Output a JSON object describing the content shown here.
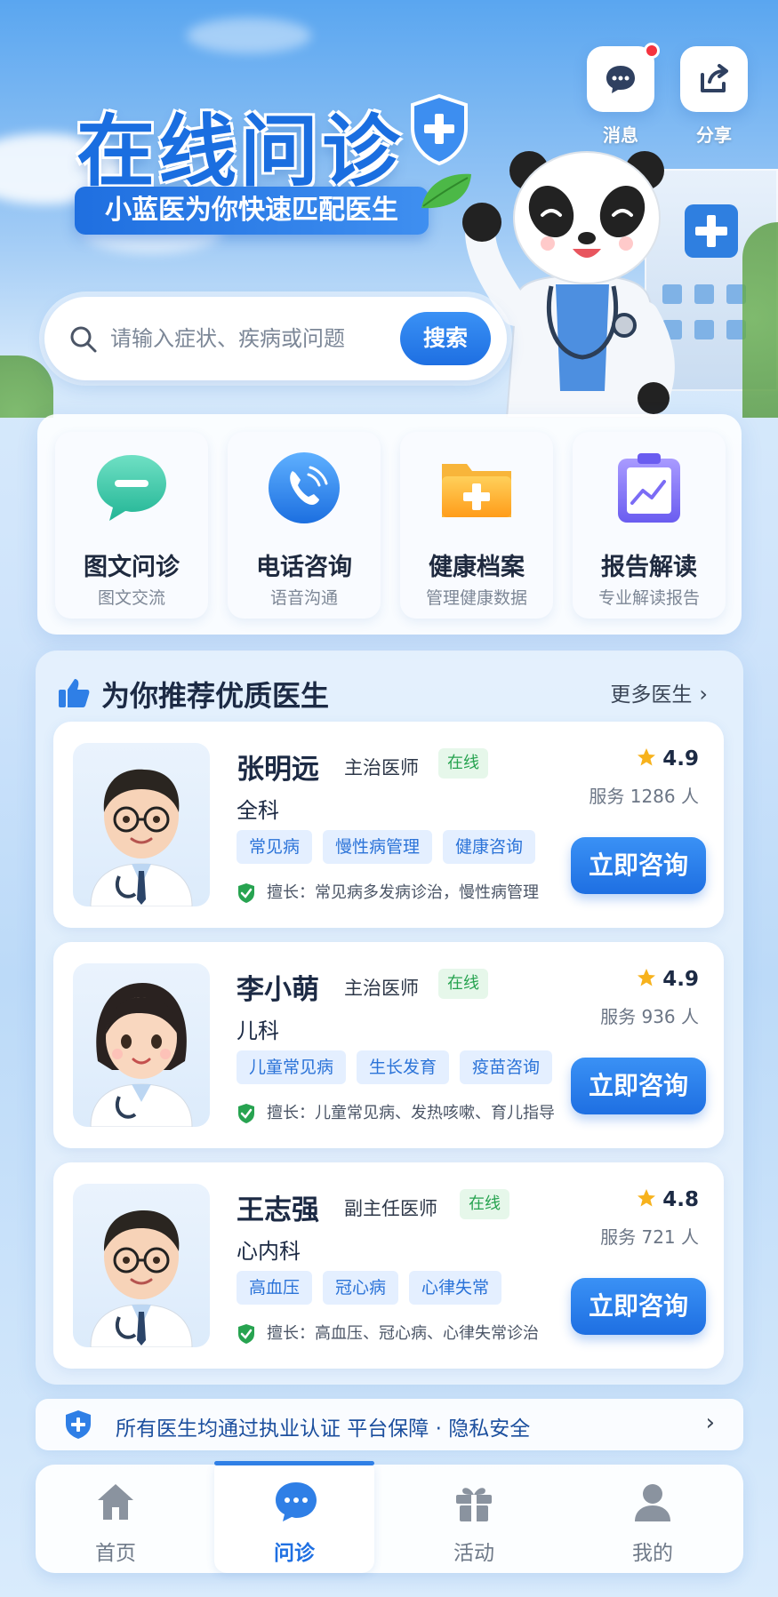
{
  "hero": {
    "title": "在线问诊",
    "subtitle": "小蓝医为你快速匹配医生",
    "actions": [
      {
        "label": "消息",
        "icon": "message-icon",
        "has_badge": true
      },
      {
        "label": "分享",
        "icon": "share-icon"
      }
    ]
  },
  "search": {
    "placeholder": "请输入症状、疾病或问题",
    "button_label": "搜索"
  },
  "services": [
    {
      "title": "图文问诊",
      "subtitle": "图文交流",
      "icon": "chat-bubble-icon"
    },
    {
      "title": "电话咨询",
      "subtitle": "语音沟通",
      "icon": "phone-icon"
    },
    {
      "title": "健康档案",
      "subtitle": "管理健康数据",
      "icon": "health-folder-icon"
    },
    {
      "title": "报告解读",
      "subtitle": "专业解读报告",
      "icon": "report-clipboard-icon"
    }
  ],
  "doctors_section": {
    "title": "为你推荐优质医生",
    "more_label": "更多医生",
    "consult_label": "立即咨询",
    "doctors": [
      {
        "name": "张明远",
        "title": "主治医师",
        "status": "在线",
        "department": "全科",
        "tags": [
          "常见病",
          "慢性病管理",
          "健康咨询"
        ],
        "skill": "擅长：常见病多发病诊治，慢性病管理",
        "rating": "4.9",
        "served": "服务 1286 人"
      },
      {
        "name": "李小萌",
        "title": "主治医师",
        "status": "在线",
        "department": "儿科",
        "tags": [
          "儿童常见病",
          "生长发育",
          "疫苗咨询"
        ],
        "skill": "擅长：儿童常见病、发热咳嗽、育儿指导",
        "rating": "4.9",
        "served": "服务 936 人"
      },
      {
        "name": "王志强",
        "title": "副主任医师",
        "status": "在线",
        "department": "心内科",
        "tags": [
          "高血压",
          "冠心病",
          "心律失常"
        ],
        "skill": "擅长：高血压、冠心病、心律失常诊治",
        "rating": "4.8",
        "served": "服务 721 人"
      }
    ]
  },
  "notice": {
    "text": "所有医生均通过执业认证   平台保障 · 隐私安全"
  },
  "bottom_nav": {
    "items": [
      {
        "label": "首页",
        "icon": "home-icon"
      },
      {
        "label": "问诊",
        "icon": "consult-chat-icon",
        "active": true
      },
      {
        "label": "活动",
        "icon": "gift-icon"
      },
      {
        "label": "我的",
        "icon": "profile-icon"
      }
    ]
  },
  "colors": {
    "brand": "#1e6fe2",
    "online_text": "#27a350",
    "tag_bg": "#e4efff"
  }
}
